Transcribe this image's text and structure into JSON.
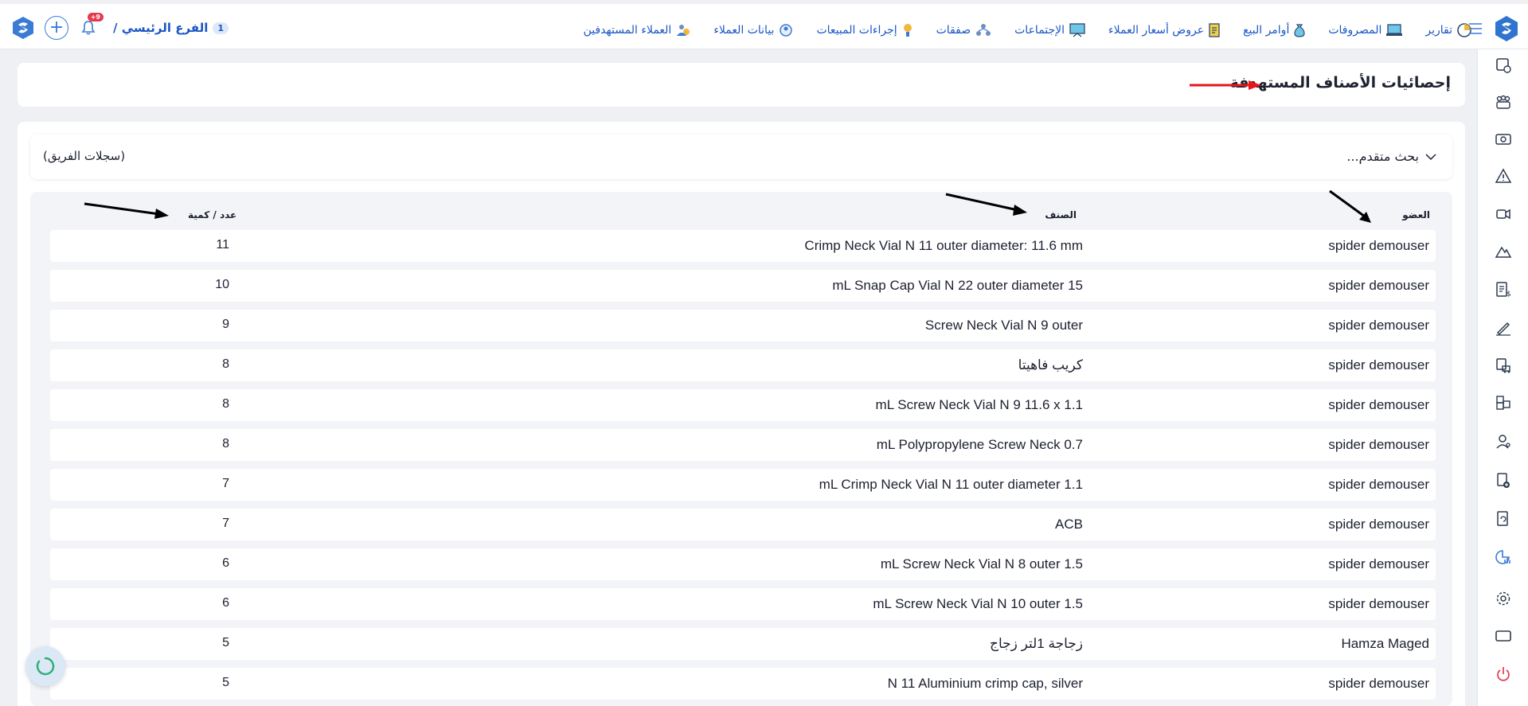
{
  "header": {
    "branch_name": "الفرع الرئيسي /",
    "branch_number": "1",
    "notification_badge": "+9",
    "nav": [
      {
        "label": "العملاء المستهدفين",
        "icon": "target-users-icon"
      },
      {
        "label": "بيانات العملاء",
        "icon": "customer-data-icon"
      },
      {
        "label": "إجراءات المبيعات",
        "icon": "sales-actions-icon"
      },
      {
        "label": "صفقات",
        "icon": "deals-icon"
      },
      {
        "label": "الإجتماعات",
        "icon": "meetings-icon"
      },
      {
        "label": "عروض أسعار العملاء",
        "icon": "quotes-icon"
      },
      {
        "label": "أوامر البيع",
        "icon": "sales-orders-icon"
      },
      {
        "label": "المصروفات",
        "icon": "expenses-icon"
      },
      {
        "label": "تقارير",
        "icon": "reports-icon"
      }
    ]
  },
  "page": {
    "title": "إحصائيات الأصناف المستهدفة"
  },
  "filters": {
    "advanced_search": "بحث متقدم...",
    "team_records": "(سجلات الفريق)"
  },
  "table": {
    "headers": {
      "member": "العضو",
      "item": "الصنف",
      "quantity": "عدد / كمية"
    },
    "rows": [
      {
        "member": "spider demouser",
        "item": "Crimp Neck Vial N 11 outer diameter: 11.6 mm",
        "quantity": "11"
      },
      {
        "member": "spider demouser",
        "item": "mL Snap Cap Vial N 22 outer diameter 15",
        "quantity": "10"
      },
      {
        "member": "spider demouser",
        "item": "Screw Neck Vial N 9 outer",
        "quantity": "9"
      },
      {
        "member": "spider demouser",
        "item": "كريب فاهيتا",
        "quantity": "8"
      },
      {
        "member": "spider demouser",
        "item": "mL Screw Neck Vial N 9 11.6 x 1.1",
        "quantity": "8"
      },
      {
        "member": "spider demouser",
        "item": "mL Polypropylene Screw Neck 0.7",
        "quantity": "8"
      },
      {
        "member": "spider demouser",
        "item": "mL Crimp Neck Vial N 11 outer diameter 1.1",
        "quantity": "7"
      },
      {
        "member": "spider demouser",
        "item": "ACB",
        "quantity": "7"
      },
      {
        "member": "spider demouser",
        "item": "mL Screw Neck Vial N 8 outer 1.5",
        "quantity": "6"
      },
      {
        "member": "spider demouser",
        "item": "mL Screw Neck Vial N 10 outer 1.5",
        "quantity": "6"
      },
      {
        "member": "Hamza Maged",
        "item": "زجاجة 1لتر زجاج",
        "quantity": "5"
      },
      {
        "member": "spider demouser",
        "item": "N 11 Aluminium crimp cap, silver",
        "quantity": "5"
      }
    ]
  },
  "sidebar": {
    "icons": [
      "new-record-icon",
      "team-icon",
      "money-icon",
      "warning-icon",
      "video-call-icon",
      "mountain-icon",
      "invoice-icon",
      "signature-icon",
      "delivery-icon",
      "boxes-icon",
      "user-icon",
      "add-document-icon",
      "refresh-document-icon",
      "analytics-icon",
      "settings-icon",
      "window-icon",
      "power-icon"
    ],
    "active": "analytics-icon"
  },
  "colors": {
    "accent": "#1a56c4",
    "badge": "#e53950",
    "red_arrow": "#e8151b",
    "page_bg": "#eef0f3"
  }
}
